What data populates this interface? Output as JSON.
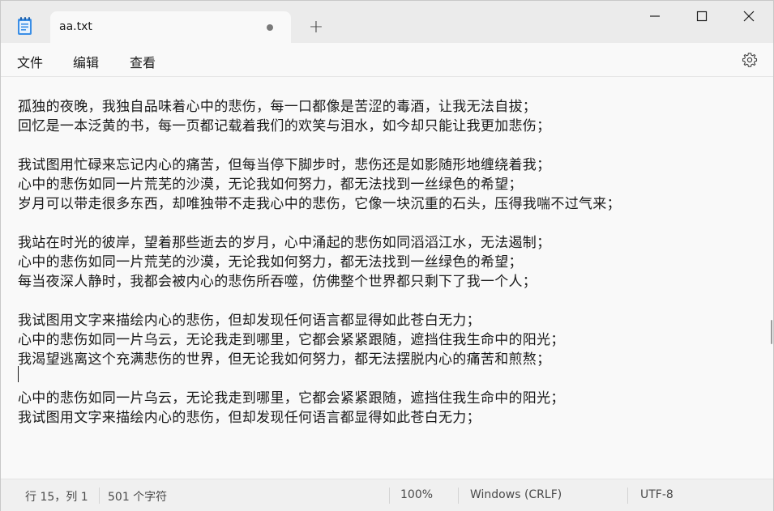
{
  "tab": {
    "title": "aa.txt",
    "new_tab_glyph": "+"
  },
  "window_controls": [
    "minimize-icon",
    "maximize-icon",
    "close-icon"
  ],
  "menu": {
    "file": "文件",
    "edit": "编辑",
    "view": "查看"
  },
  "editor": {
    "lines": [
      "孤独的夜晚，我独自品味着心中的悲伤，每一口都像是苦涩的毒酒，让我无法自拔；",
      "回忆是一本泛黄的书，每一页都记载着我们的欢笑与泪水，如今却只能让我更加悲伤；",
      "",
      "我试图用忙碌来忘记内心的痛苦，但每当停下脚步时，悲伤还是如影随形地缠绕着我；",
      "心中的悲伤如同一片荒芜的沙漠，无论我如何努力，都无法找到一丝绿色的希望；",
      "岁月可以带走很多东西，却唯独带不走我心中的悲伤，它像一块沉重的石头，压得我喘不过气来；",
      "",
      "我站在时光的彼岸，望着那些逝去的岁月，心中涌起的悲伤如同滔滔江水，无法遏制；",
      "心中的悲伤如同一片荒芜的沙漠，无论我如何努力，都无法找到一丝绿色的希望；",
      "每当夜深人静时，我都会被内心的悲伤所吞噬，仿佛整个世界都只剩下了我一个人；",
      "",
      "我试图用文字来描绘内心的悲伤，但却发现任何语言都显得如此苍白无力；",
      "心中的悲伤如同一片乌云，无论我走到哪里，它都会紧紧跟随，遮挡住我生命中的阳光；",
      "我渴望逃离这个充满悲伤的世界，但无论我如何努力，都无法摆脱内心的痛苦和煎熬；",
      "",
      "心中的悲伤如同一片乌云，无论我走到哪里，它都会紧紧跟随，遮挡住我生命中的阳光；",
      "我试图用文字来描绘内心的悲伤，但却发现任何语言都显得如此苍白无力；"
    ]
  },
  "status": {
    "position": "行 15，列 1",
    "chars": "501 个字符",
    "zoom": "100%",
    "line_ending": "Windows (CRLF)",
    "encoding": "UTF-8"
  }
}
